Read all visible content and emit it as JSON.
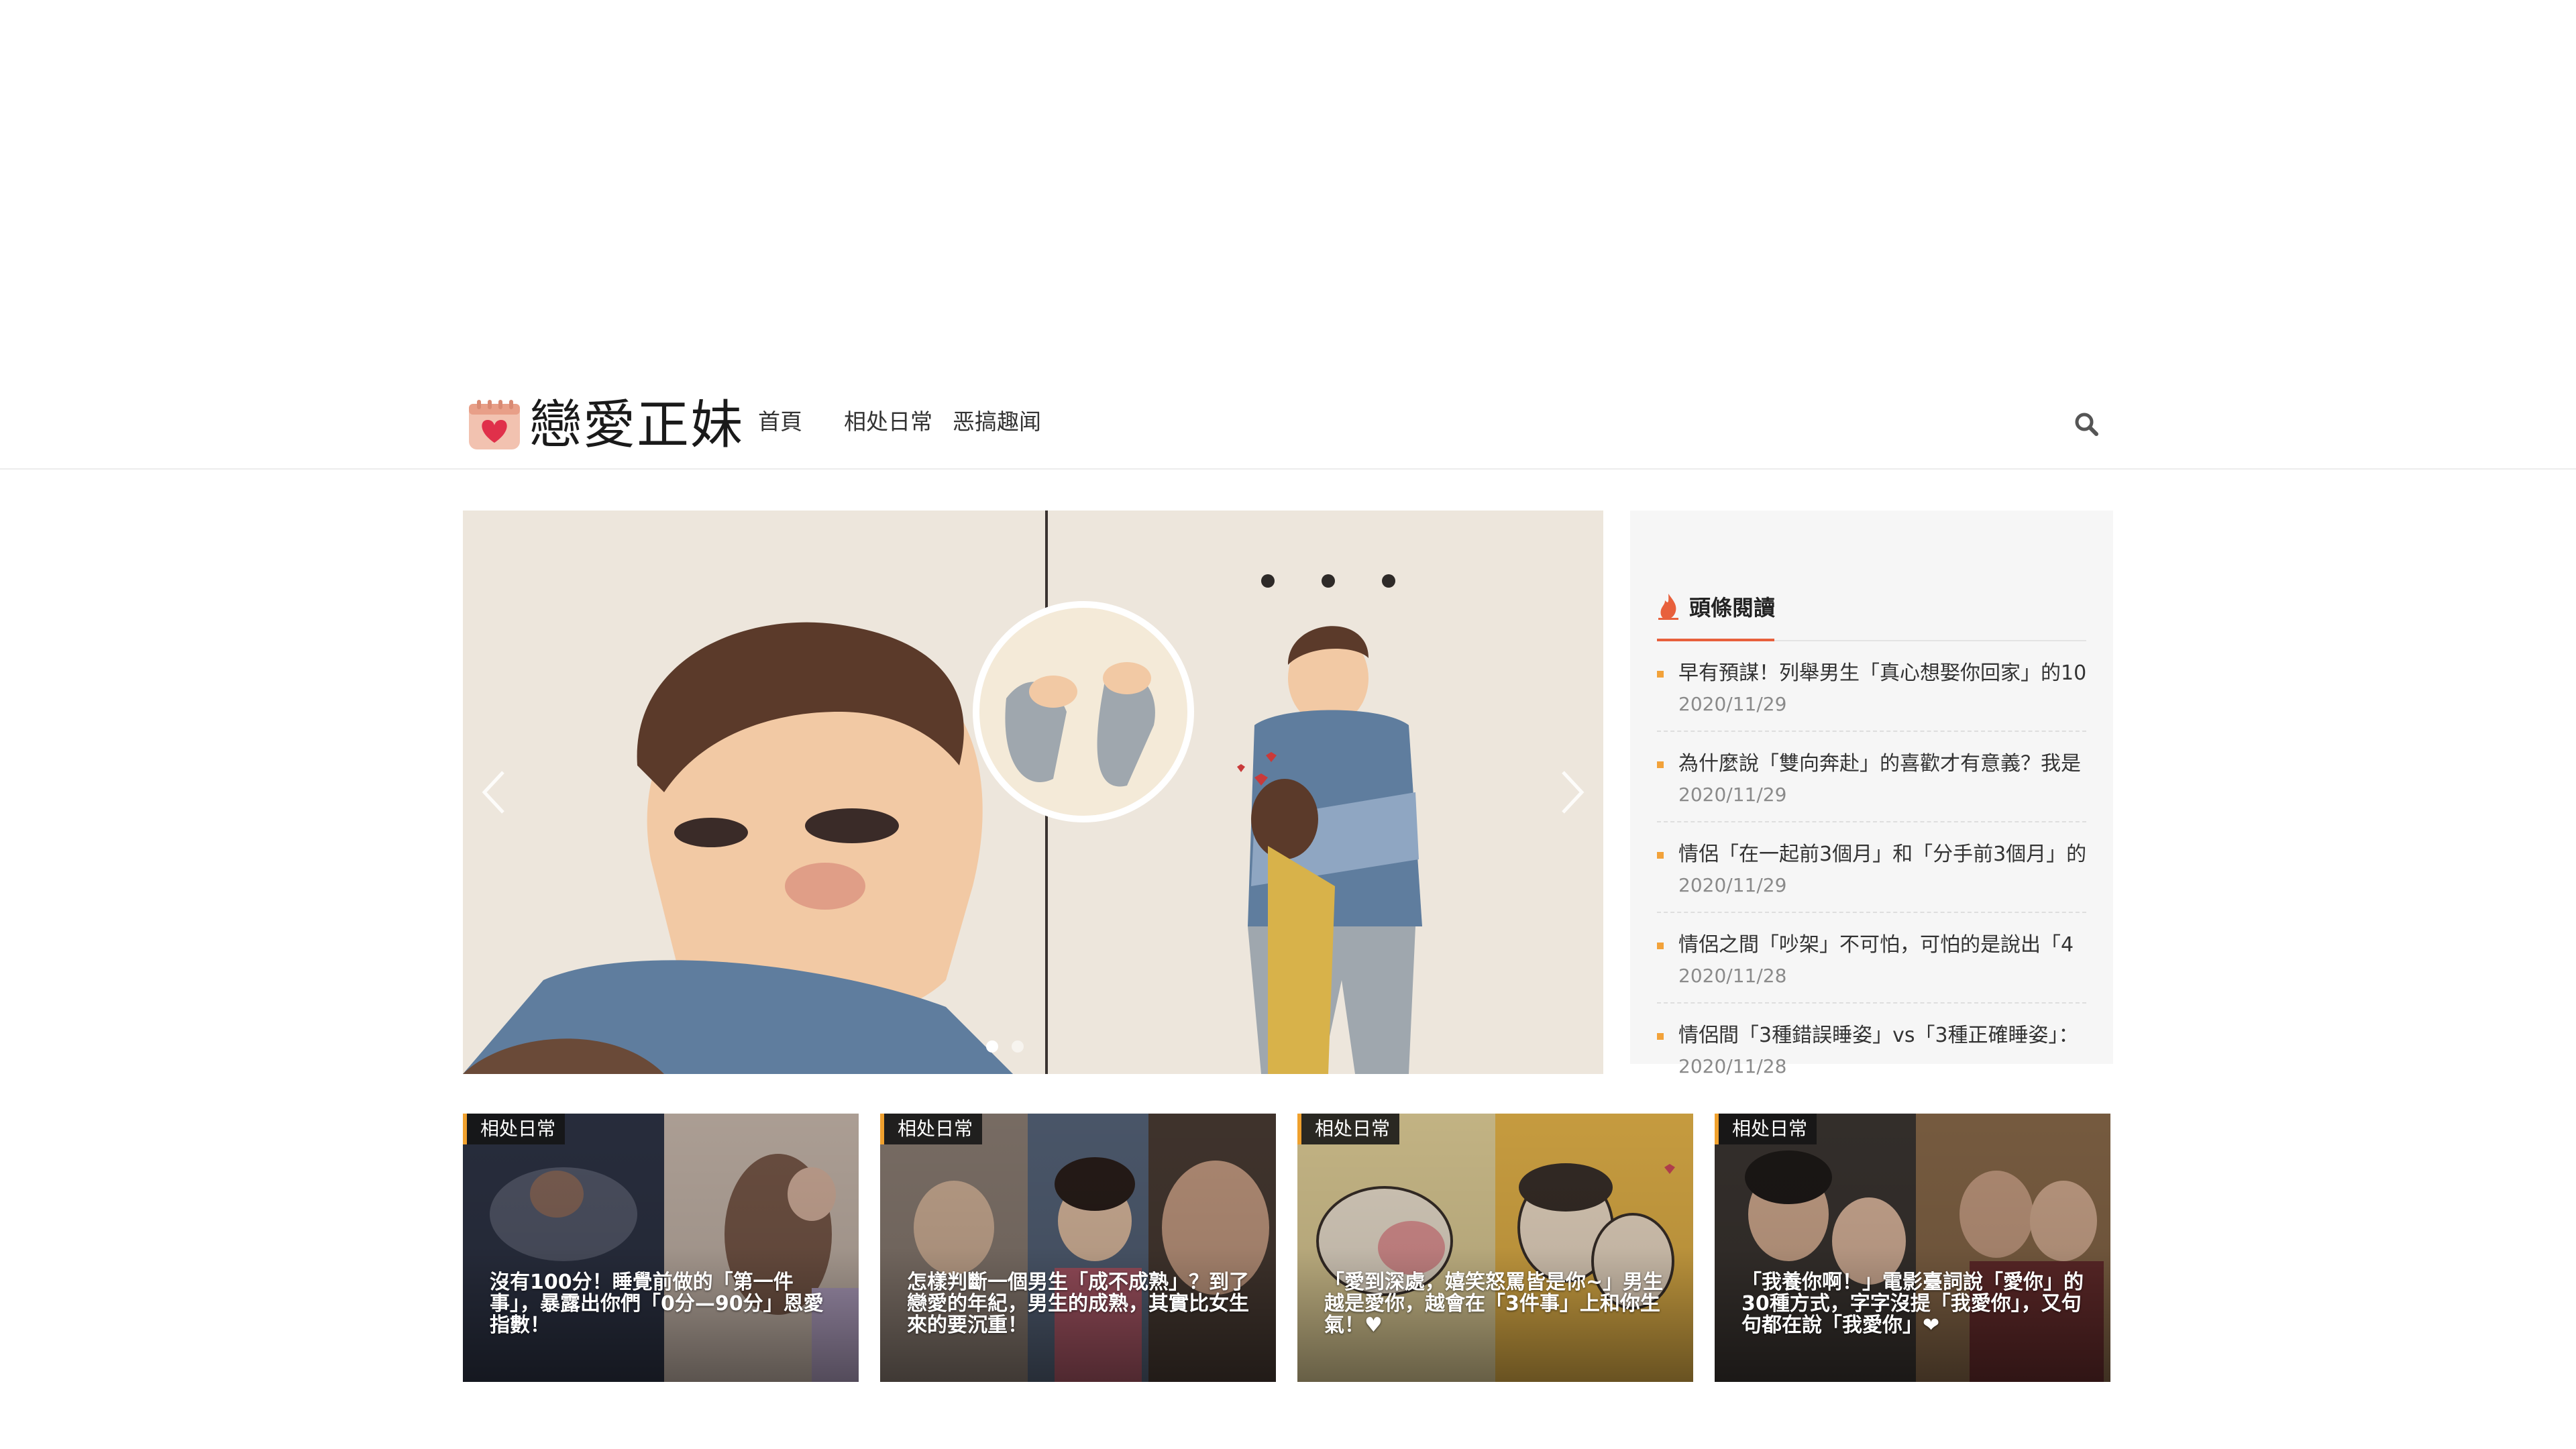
{
  "site": {
    "name": "戀愛正妹",
    "logo_icon": "heart-calendar-icon"
  },
  "nav": {
    "items": [
      {
        "label": "首頁"
      },
      {
        "label": "相处日常"
      },
      {
        "label": "恶搞趣闻"
      }
    ],
    "search_icon": "search-icon"
  },
  "slider": {
    "slide_count": 2,
    "active_index": 0,
    "prev_icon": "chevron-left-icon",
    "next_icon": "chevron-right-icon"
  },
  "sidebar": {
    "title": "頭條閱讀",
    "title_icon": "fire-icon",
    "items": [
      {
        "title": "早有預謀！列舉男生「真心想娶你回家」的10",
        "date": "2020/11/29"
      },
      {
        "title": "為什麼說「雙向奔赴」的喜歡才有意義？我是",
        "date": "2020/11/29"
      },
      {
        "title": "情侶「在一起前3個月」和「分手前3個月」的",
        "date": "2020/11/29"
      },
      {
        "title": "情侶之間「吵架」不可怕，可怕的是說出「4",
        "date": "2020/11/28"
      },
      {
        "title": "情侶間「3種錯誤睡姿」vs「3種正確睡姿」：",
        "date": "2020/11/28"
      }
    ]
  },
  "cards": [
    {
      "tag": "相处日常",
      "title": "沒有100分！睡覺前做的「第一件事」，暴露出你們「0分—90分」恩愛指數！"
    },
    {
      "tag": "相处日常",
      "title": "怎樣判斷一個男生「成不成熟」？到了戀愛的年紀，男生的成熟，其實比女生來的要沉重！"
    },
    {
      "tag": "相处日常",
      "title": "「愛到深處，嬉笑怒罵皆是你~」男生越是愛你，越會在「3件事」上和你生氣！♥"
    },
    {
      "tag": "相处日常",
      "title": "「我養你啊！」電影臺詞說「愛你」的30種方式，字字沒提「我愛你」，又句句都在說「我愛你」❤"
    }
  ],
  "colors": {
    "accent": "#f0a12e",
    "sidebar_underline": "#e8603c",
    "sidebar_bg": "#f6f6f6"
  }
}
